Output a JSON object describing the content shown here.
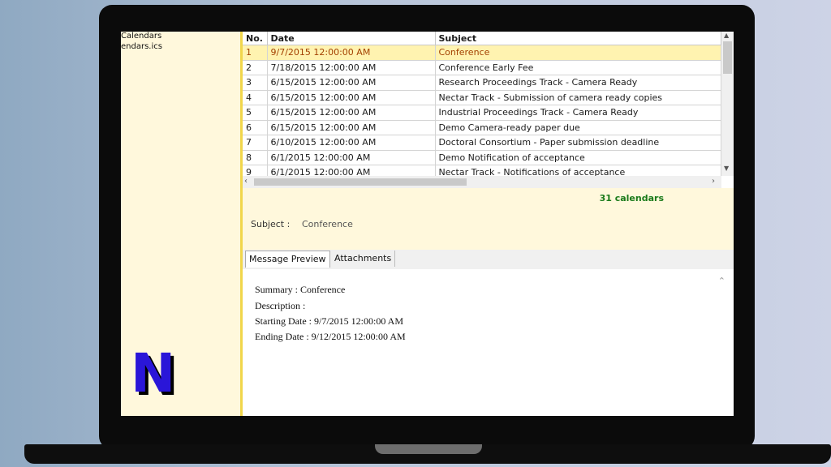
{
  "tree": [
    "Calendars",
    "endars.ics"
  ],
  "table": {
    "headers": [
      "No.",
      "Date",
      "Subject"
    ],
    "rows": [
      [
        "1",
        "9/7/2015 12:00:00 AM",
        "Conference"
      ],
      [
        "2",
        "7/18/2015 12:00:00 AM",
        "Conference Early Fee"
      ],
      [
        "3",
        "6/15/2015 12:00:00 AM",
        "Research Proceedings Track - Camera Ready"
      ],
      [
        "4",
        "6/15/2015 12:00:00 AM",
        "Nectar Track - Submission of camera ready copies"
      ],
      [
        "5",
        "6/15/2015 12:00:00 AM",
        "Industrial Proceedings Track - Camera Ready"
      ],
      [
        "6",
        "6/15/2015 12:00:00 AM",
        "Demo Camera-ready paper due"
      ],
      [
        "7",
        "6/10/2015 12:00:00 AM",
        "Doctoral Consortium - Paper submission deadline"
      ],
      [
        "8",
        "6/1/2015 12:00:00 AM",
        "Demo Notification of acceptance"
      ],
      [
        "9",
        "6/1/2015 12:00:00 AM",
        "Nectar Track - Notifications of acceptance"
      ]
    ]
  },
  "count_label": "31 calendars",
  "subject": {
    "label": "Subject :",
    "value": "Conference"
  },
  "tabs": [
    "Message Preview",
    "Attachments"
  ],
  "preview": {
    "lines": [
      "Summary : Conference",
      "Description :",
      "Starting Date : 9/7/2015 12:00:00 AM",
      "Ending Date : 9/12/2015 12:00:00 AM"
    ]
  },
  "logo": {
    "letter": "N"
  },
  "icons": {
    "scroll_up": "chevron-up",
    "scroll_down": "chevron-down",
    "scroll_left": "chevron-left",
    "scroll_right": "chevron-right"
  },
  "colors": {
    "selected_row_bg": "#fff3b0",
    "selected_row_text": "#a34000",
    "count_text": "#1a7a1a",
    "pane_bg": "#fff8dc",
    "logo_fill": "#2a16d8"
  }
}
